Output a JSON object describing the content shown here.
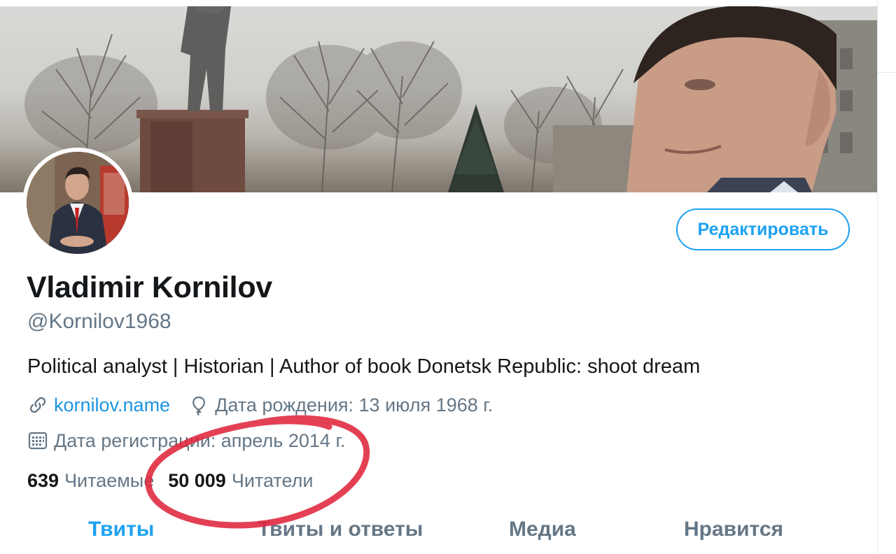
{
  "profile": {
    "name": "Vladimir Kornilov",
    "handle": "@Kornilov1968",
    "bio": "Political analyst | Historian | Author of book Donetsk Republic: shoot dream",
    "website": "kornilov.name",
    "birthday": "Дата рождения: 13 июля 1968 г.",
    "joined": "Дата регистрации: апрель 2014 г."
  },
  "actions": {
    "edit_label": "Редактировать"
  },
  "stats": {
    "following_count": "639",
    "following_label": "Читаемые",
    "followers_count": "50 009",
    "followers_label": "Читатели"
  },
  "tabs": [
    {
      "label": "Твиты",
      "active": true
    },
    {
      "label": "Твиты и ответы",
      "active": false
    },
    {
      "label": "Медиа",
      "active": false
    },
    {
      "label": "Нравится",
      "active": false
    }
  ],
  "icons": {
    "link": "link-icon",
    "birthday": "balloon-icon",
    "calendar": "calendar-icon"
  },
  "colors": {
    "accent": "#1da1f2",
    "link": "#1b95e0",
    "secondary_text": "#657786",
    "annotation": "#e0263c"
  }
}
